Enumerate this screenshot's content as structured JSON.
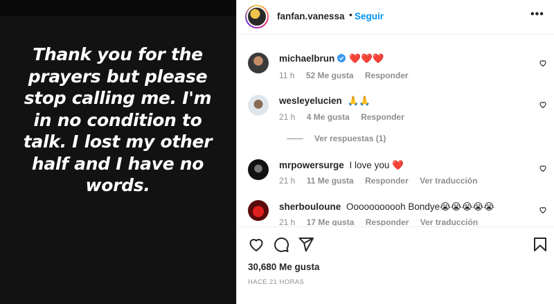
{
  "story": {
    "quote_lines": [
      "Thank you for the",
      "prayers but please",
      "stop calling me. I'm",
      "in no condition to",
      "talk. I lost my other",
      "half and I have no",
      "words."
    ]
  },
  "post": {
    "username": "fanfan.vanessa",
    "separator": "•",
    "follow_label": "Seguir",
    "more_label": "•••"
  },
  "comments": [
    {
      "username": "michaelbrun",
      "verified": true,
      "text": "❤️❤️❤️",
      "time": "11 h",
      "likes": "52 Me gusta",
      "reply": "Responder",
      "translate": ""
    },
    {
      "username": "wesleyelucien",
      "verified": false,
      "text": "🙏🙏",
      "time": "21 h",
      "likes": "4 Me gusta",
      "reply": "Responder",
      "translate": ""
    },
    {
      "username": "mrpowersurge",
      "verified": false,
      "text": "I love you ❤️",
      "time": "21 h",
      "likes": "11 Me gusta",
      "reply": "Responder",
      "translate": "Ver traducción"
    },
    {
      "username": "sherbouloune",
      "verified": false,
      "text": "Ooooooooooh Bondye😭😭😭😭😭",
      "time": "21 h",
      "likes": "17 Me gusta",
      "reply": "Responder",
      "translate": "Ver traducción"
    }
  ],
  "view_replies": "Ver respuestas (1)",
  "footer": {
    "likes": "30,680 Me gusta",
    "timestamp": "HACE 21 HORAS"
  },
  "icons": {
    "like": "heart-icon",
    "comment": "comment-icon",
    "share": "share-icon",
    "save": "bookmark-icon",
    "verified": "verified-badge-icon"
  },
  "colors": {
    "accent": "#0095f6",
    "verified": "#3897f0",
    "story_bg": "#121212"
  }
}
